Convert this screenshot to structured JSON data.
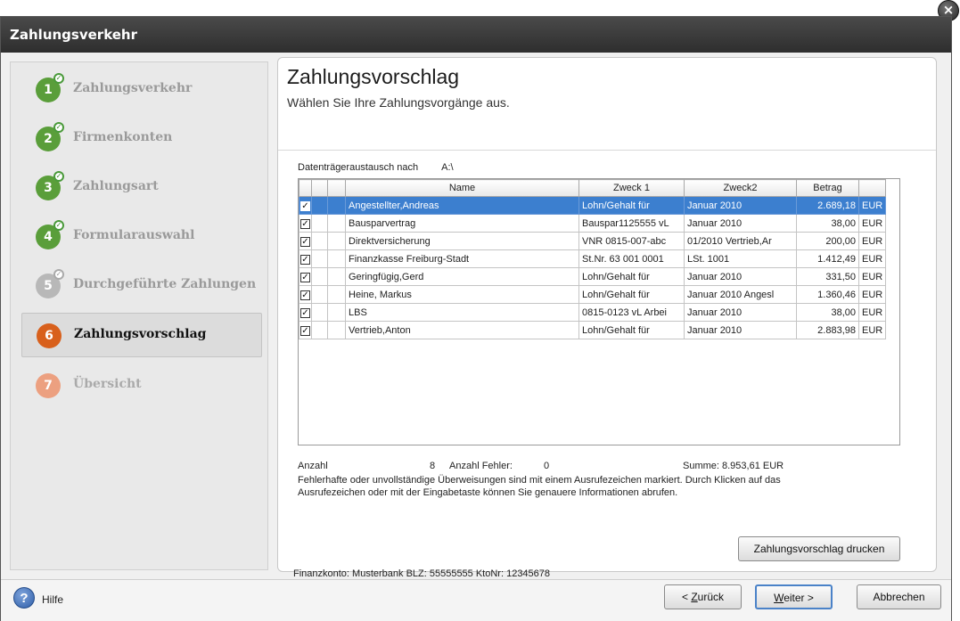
{
  "window": {
    "title": "Zahlungsverkehr",
    "close_label": "×"
  },
  "steps": [
    {
      "number": "1",
      "label": "Zahlungsverkehr",
      "state": "done"
    },
    {
      "number": "2",
      "label": "Firmenkonten",
      "state": "done"
    },
    {
      "number": "3",
      "label": "Zahlungsart",
      "state": "done"
    },
    {
      "number": "4",
      "label": "Formularauswahl",
      "state": "done"
    },
    {
      "number": "5",
      "label": "Durchgeführte Zahlungen",
      "state": "gray"
    },
    {
      "number": "6",
      "label": "Zahlungsvorschlag",
      "state": "active"
    },
    {
      "number": "7",
      "label": "Übersicht",
      "state": "future"
    }
  ],
  "page": {
    "title": "Zahlungsvorschlag",
    "subtitle": "Wählen Sie Ihre Zahlungsvorgänge aus."
  },
  "exchange": {
    "label": "Datenträgeraustausch nach",
    "target": "A:\\"
  },
  "table": {
    "columns": [
      "",
      "",
      "",
      "Name",
      "Zweck 1",
      "Zweck2",
      "Betrag",
      ""
    ],
    "rows": [
      {
        "checked": "✓",
        "name": "Angestellter,Andreas",
        "zweck1": "Lohn/Gehalt für",
        "zweck2": "Januar 2010",
        "betrag": "2.689,18",
        "currency": "EUR",
        "selected": true
      },
      {
        "checked": "✓",
        "name": "Bausparvertrag",
        "zweck1": "Bauspar1125555 vL",
        "zweck2": "Januar 2010",
        "betrag": "38,00",
        "currency": "EUR",
        "selected": false
      },
      {
        "checked": "✓",
        "name": "Direktversicherung",
        "zweck1": "VNR 0815-007-abc",
        "zweck2": "01/2010 Vertrieb,Ar",
        "betrag": "200,00",
        "currency": "EUR",
        "selected": false
      },
      {
        "checked": "✓",
        "name": "Finanzkasse Freiburg-Stadt",
        "zweck1": "St.Nr. 63 001 0001",
        "zweck2": "LSt. 1001",
        "betrag": "1.412,49",
        "currency": "EUR",
        "selected": false
      },
      {
        "checked": "✓",
        "name": "Geringfügig,Gerd",
        "zweck1": "Lohn/Gehalt für",
        "zweck2": "Januar 2010",
        "betrag": "331,50",
        "currency": "EUR",
        "selected": false
      },
      {
        "checked": "✓",
        "name": "Heine, Markus",
        "zweck1": "Lohn/Gehalt für",
        "zweck2": "Januar 2010 Angesl",
        "betrag": "1.360,46",
        "currency": "EUR",
        "selected": false
      },
      {
        "checked": "✓",
        "name": "LBS",
        "zweck1": "0815-0123 vL Arbei",
        "zweck2": "Januar 2010",
        "betrag": "38,00",
        "currency": "EUR",
        "selected": false
      },
      {
        "checked": "✓",
        "name": "Vertrieb,Anton",
        "zweck1": "Lohn/Gehalt für",
        "zweck2": "Januar 2010",
        "betrag": "2.883,98",
        "currency": "EUR",
        "selected": false
      }
    ]
  },
  "summary": {
    "count_label": "Anzahl",
    "count_value": "8",
    "errors_label": "Anzahl Fehler:",
    "errors_value": "0",
    "sum": "Summe: 8.953,61 EUR"
  },
  "note": "Fehlerhafte oder unvollständige Überweisungen sind mit einem Ausrufezeichen markiert. Durch Klicken auf das Ausrufezeichen oder mit der Eingabetaste können Sie genauere Informationen abrufen.",
  "buttons": {
    "print": "Zahlungsvorschlag drucken",
    "back_prefix": "< ",
    "back_underlined": "Z",
    "back_rest": "urück",
    "next_prefix": "",
    "next_underlined": "W",
    "next_rest": "eiter >",
    "cancel": "Abbrechen",
    "help": "Hilfe",
    "help_icon": "?"
  },
  "footer": {
    "finance_account": "Finanzkonto: Musterbank  BLZ: 55555555  KtoNr: 12345678"
  }
}
